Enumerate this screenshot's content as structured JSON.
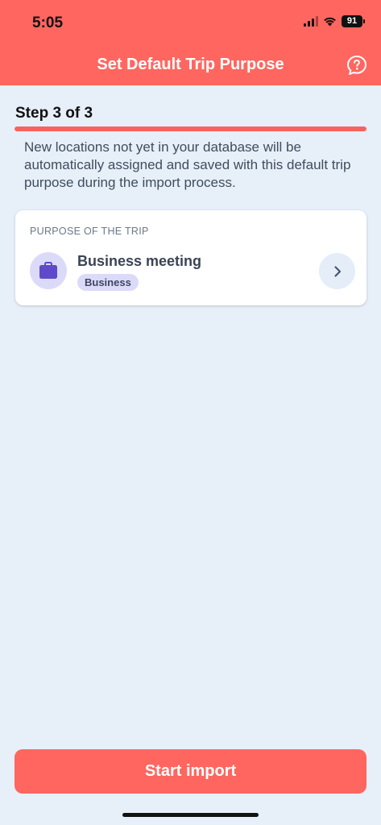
{
  "status_bar": {
    "time": "5:05",
    "battery": "91"
  },
  "header": {
    "title": "Set Default Trip Purpose",
    "help_icon": "help-bubble-icon"
  },
  "step": {
    "label": "Step 3 of 3",
    "current": 3,
    "total": 3,
    "progress": 1.0
  },
  "description": "New locations not yet in your database will be automatically assigned and saved with this default trip purpose during the import process.",
  "purpose_card": {
    "section_label": "PURPOSE OF THE TRIP",
    "icon": "briefcase-icon",
    "title": "Business meeting",
    "badge": "Business",
    "action_icon": "chevron-right-icon"
  },
  "footer": {
    "start_button": "Start import"
  },
  "colors": {
    "accent": "#ff6660",
    "background": "#e7eff9",
    "purpose_tint": "#dcdaf9",
    "purpose_icon": "#5f4bc9"
  }
}
